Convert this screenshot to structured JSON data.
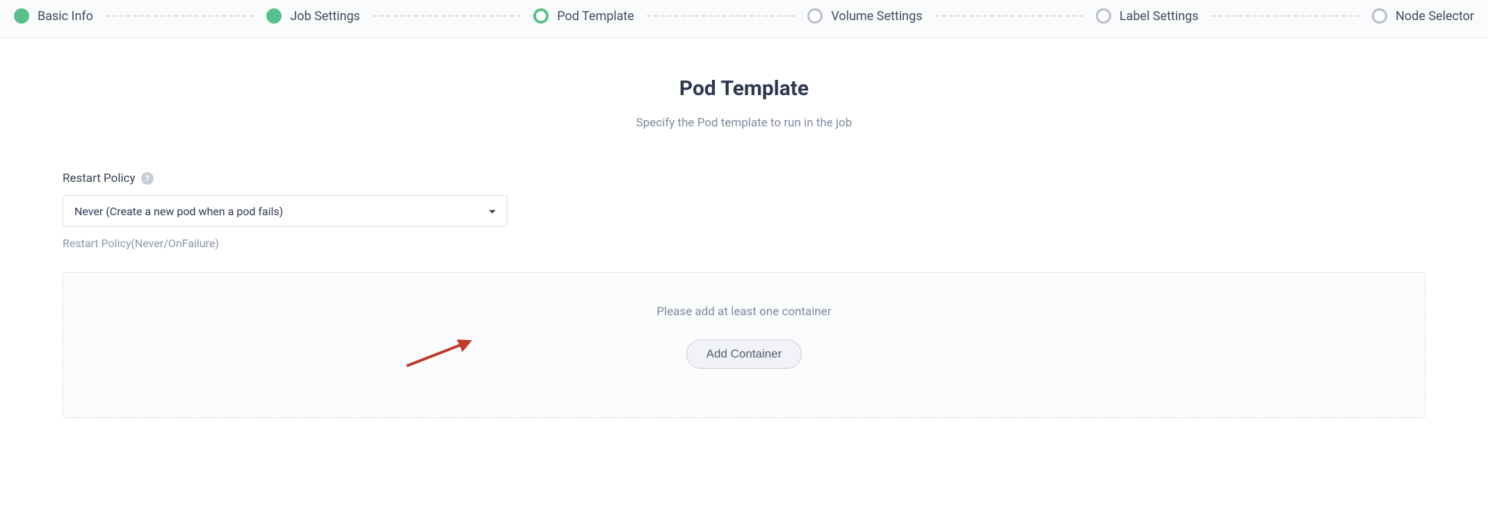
{
  "stepper": {
    "steps": [
      {
        "label": "Basic Info",
        "state": "done"
      },
      {
        "label": "Job Settings",
        "state": "done"
      },
      {
        "label": "Pod Template",
        "state": "current"
      },
      {
        "label": "Volume Settings",
        "state": "pending"
      },
      {
        "label": "Label Settings",
        "state": "pending"
      },
      {
        "label": "Node Selector",
        "state": "pending"
      }
    ]
  },
  "header": {
    "title": "Pod Template",
    "subtitle": "Specify the Pod template to run in the job"
  },
  "restart_policy": {
    "label": "Restart Policy",
    "help_glyph": "?",
    "selected": "Never (Create a new pod when a pod fails)",
    "hint": "Restart Policy(Never/OnFailure)"
  },
  "container_panel": {
    "message": "Please add at least one container",
    "button": "Add Container"
  }
}
